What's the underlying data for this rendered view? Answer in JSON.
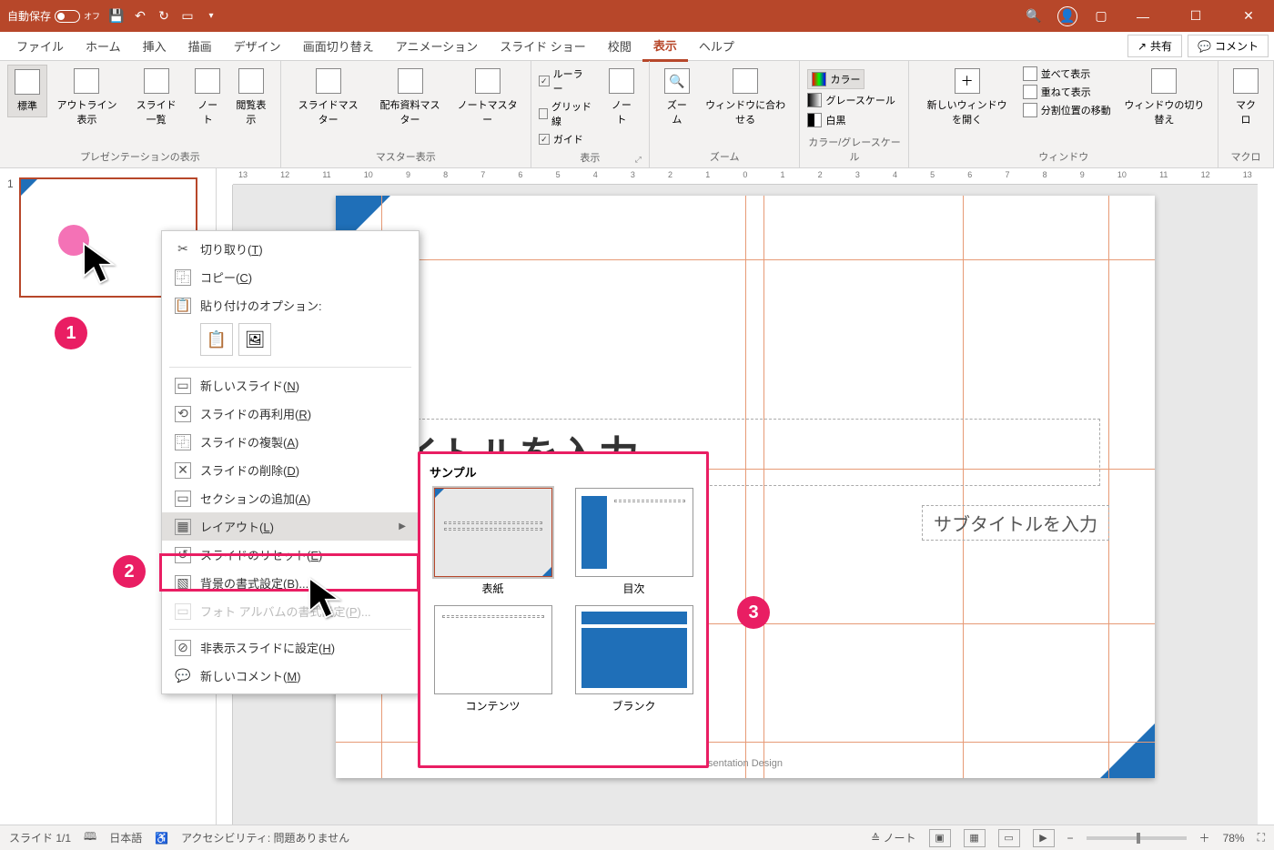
{
  "titlebar": {
    "autosave_label": "自動保存",
    "autosave_state": "オフ"
  },
  "tabs": {
    "file": "ファイル",
    "home": "ホーム",
    "insert": "挿入",
    "draw": "描画",
    "design": "デザイン",
    "transitions": "画面切り替え",
    "animations": "アニメーション",
    "slideshow": "スライド ショー",
    "review": "校閲",
    "view": "表示",
    "help": "ヘルプ",
    "share": "共有",
    "comment": "コメント"
  },
  "ribbon": {
    "presentation_views": {
      "normal": "標準",
      "outline": "アウトライン表示",
      "slide_sorter": "スライド一覧",
      "notes_page": "ノート",
      "reading_view": "閲覧表示",
      "group": "プレゼンテーションの表示"
    },
    "master_views": {
      "slide_master": "スライドマスター",
      "handout_master": "配布資料マスター",
      "notes_master": "ノートマスター",
      "group": "マスター表示"
    },
    "show": {
      "ruler": "ルーラー",
      "gridlines": "グリッド線",
      "guides": "ガイド",
      "notes": "ノート",
      "group": "表示"
    },
    "zoom": {
      "zoom": "ズーム",
      "fit": "ウィンドウに合わせる",
      "group": "ズーム"
    },
    "color": {
      "color": "カラー",
      "grayscale": "グレースケール",
      "bw": "白黒",
      "group": "カラー/グレースケール"
    },
    "window": {
      "new_window": "新しいウィンドウを開く",
      "arrange_all": "並べて表示",
      "cascade": "重ねて表示",
      "move_split": "分割位置の移動",
      "switch": "ウィンドウの切り替え",
      "group": "ウィンドウ"
    },
    "macros": {
      "macros": "マクロ",
      "group": "マクロ"
    }
  },
  "ruler_marks": [
    "13",
    "12",
    "11",
    "10",
    "9",
    "8",
    "7",
    "6",
    "5",
    "4",
    "3",
    "2",
    "1",
    "0",
    "1",
    "2",
    "3",
    "4",
    "5",
    "6",
    "7",
    "8",
    "9",
    "10",
    "11",
    "12",
    "13"
  ],
  "thumbs": {
    "num1": "1"
  },
  "slide": {
    "title_placeholder": "イトルを入力",
    "subtitle_placeholder": "サブタイトルを入力",
    "footer": "sentation Design"
  },
  "context_menu": {
    "cut": "切り取り",
    "cut_mn": "T",
    "copy": "コピー",
    "copy_mn": "C",
    "paste_options": "貼り付けのオプション:",
    "new_slide": "新しいスライド",
    "new_slide_mn": "N",
    "reuse_slides": "スライドの再利用",
    "reuse_slides_mn": "R",
    "duplicate_slide": "スライドの複製",
    "duplicate_slide_mn": "A",
    "delete_slide": "スライドの削除",
    "delete_slide_mn": "D",
    "add_section": "セクションの追加",
    "add_section_mn": "A",
    "layout": "レイアウト",
    "layout_mn": "L",
    "reset_slide": "スライドのリセット",
    "reset_slide_mn": "E",
    "format_background": "背景の書式設定",
    "format_background_mn": "B",
    "photo_album": "フォト アルバムの書式設定",
    "photo_album_mn": "P",
    "hide_slide": "非表示スライドに設定",
    "hide_slide_mn": "H",
    "new_comment": "新しいコメント",
    "new_comment_mn": "M"
  },
  "layout_flyout": {
    "title": "サンプル",
    "items": {
      "cover": "表紙",
      "toc": "目次",
      "contents": "コンテンツ",
      "blank": "ブランク"
    }
  },
  "badges": {
    "b1": "1",
    "b2": "2",
    "b3": "3"
  },
  "statusbar": {
    "slide_count": "スライド 1/1",
    "language": "日本語",
    "accessibility": "アクセシビリティ: 問題ありません",
    "notes_btn": "ノート",
    "zoom": "78%"
  }
}
